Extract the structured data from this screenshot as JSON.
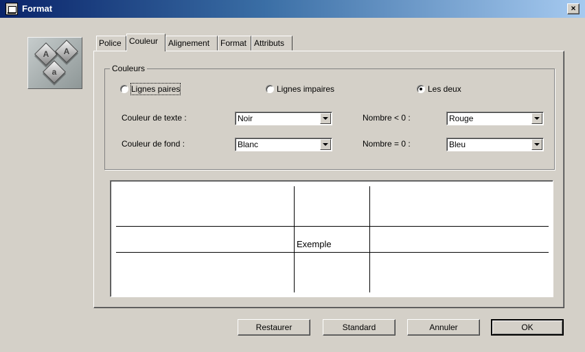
{
  "window": {
    "title": "Format",
    "close_label": "×"
  },
  "logo": {
    "icon": "abc-logo-icon",
    "letters": [
      "A",
      "A",
      "a"
    ]
  },
  "tabs": [
    {
      "label": "Police",
      "active": false
    },
    {
      "label": "Couleur",
      "active": true
    },
    {
      "label": "Alignement",
      "active": false
    },
    {
      "label": "Format",
      "active": false
    },
    {
      "label": "Attributs",
      "active": false
    }
  ],
  "colors_group": {
    "title": "Couleurs",
    "radios": [
      {
        "label": "Lignes paires",
        "checked": false
      },
      {
        "label": "Lignes impaires",
        "checked": false
      },
      {
        "label": "Les deux",
        "checked": true
      }
    ],
    "text_color": {
      "label": "Couleur de texte :",
      "value": "Noir"
    },
    "bg_color": {
      "label": "Couleur de fond :",
      "value": "Blanc"
    },
    "negative": {
      "label": "Nombre < 0 :",
      "value": "Rouge"
    },
    "zero": {
      "label": "Nombre = 0 :",
      "value": "Bleu"
    }
  },
  "sample": {
    "text": "Exemple"
  },
  "buttons": {
    "restore": "Restaurer",
    "standard": "Standard",
    "cancel": "Annuler",
    "ok": "OK"
  }
}
